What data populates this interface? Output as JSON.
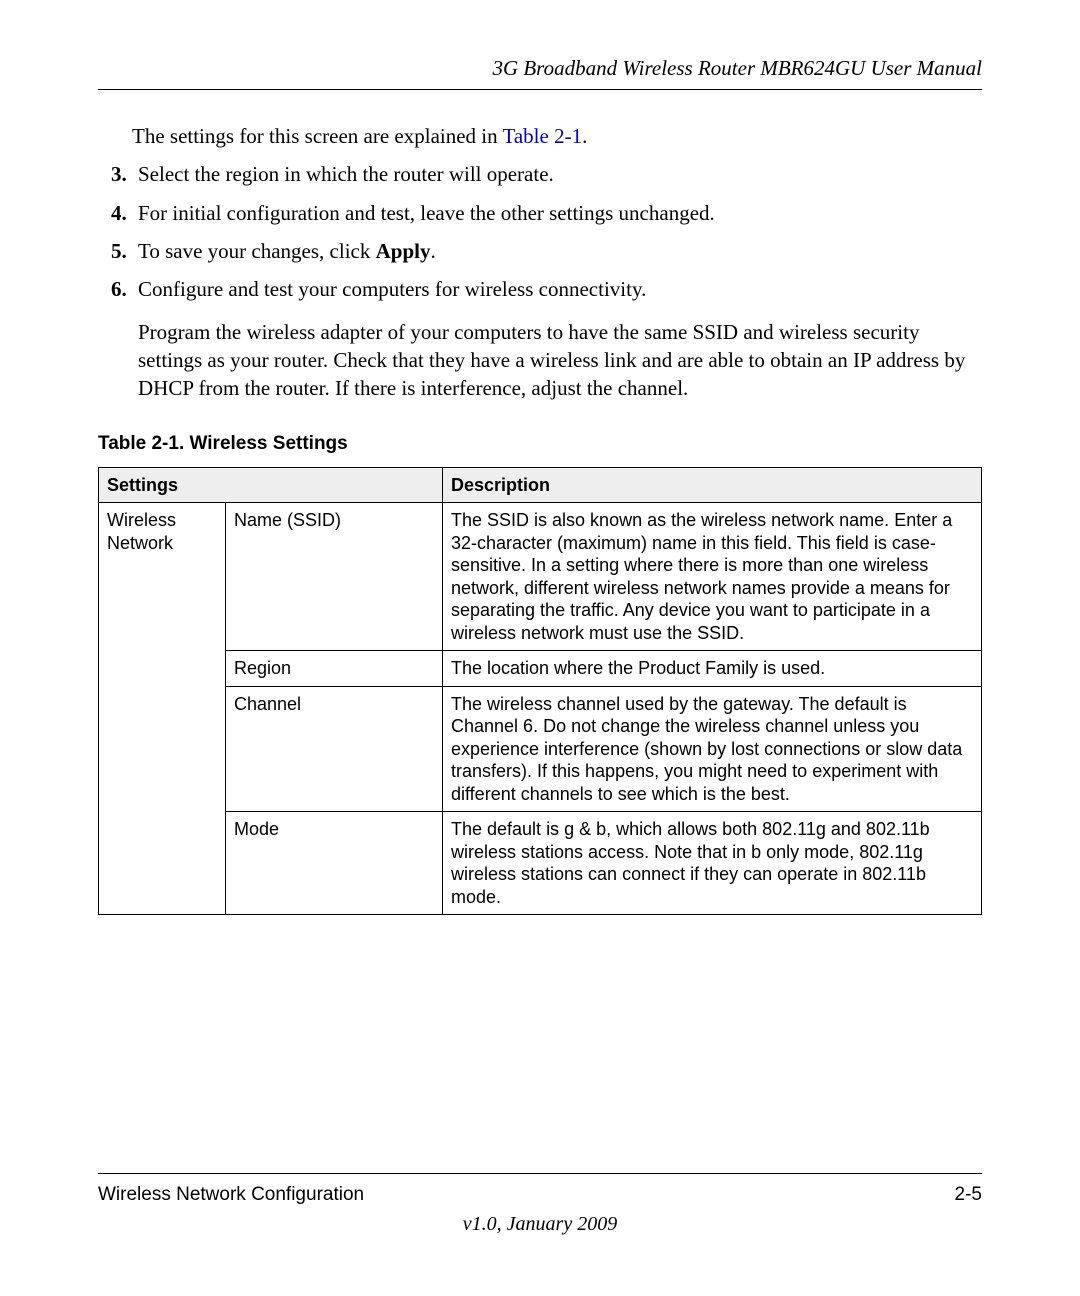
{
  "header": {
    "title": "3G Broadband Wireless Router MBR624GU User Manual"
  },
  "intro": {
    "text_pre": "The settings for this screen are explained in ",
    "link": "Table 2-1",
    "text_post": "."
  },
  "steps": {
    "start": 3,
    "item3": "Select the region in which the router will operate.",
    "item4": "For initial configuration and test, leave the other settings unchanged.",
    "item5_pre": "To save your changes, click ",
    "item5_bold": "Apply",
    "item5_post": ".",
    "item6": "Configure and test your computers for wireless connectivity.",
    "item6_follow": "Program the wireless adapter of your computers to have the same SSID and wireless security settings as your router. Check that they have a wireless link and are able to obtain an IP address by DHCP from the router. If there is interference, adjust the channel."
  },
  "table": {
    "caption": "Table 2-1.   Wireless Settings",
    "head_settings": "Settings",
    "head_description": "Description",
    "group": "Wireless Network",
    "rows": [
      {
        "setting": "Name (SSID)",
        "desc": "The SSID is also known as the wireless network name. Enter a 32-character (maximum) name in this field. This field is case-sensitive.\nIn a setting where there is more than one wireless network, different wireless network names provide a means for separating the traffic. Any device you want to participate in a wireless network must use the SSID."
      },
      {
        "setting": "Region",
        "desc": "The location where the Product Family is used."
      },
      {
        "setting": "Channel",
        "desc": "The wireless channel used by the gateway. The default is Channel 6.\nDo not change the wireless channel unless you experience interference (shown by lost connections or slow data transfers). If this happens, you might need to experiment with different channels to see which is the best."
      },
      {
        "setting": "Mode",
        "desc": "The default is g & b, which allows both 802.11g and 802.11b wireless stations access. Note that in b only mode, 802.11g wireless stations can connect if they can operate in 802.11b mode."
      }
    ]
  },
  "footer": {
    "section": "Wireless Network Configuration",
    "page": "2-5",
    "version": "v1.0, January 2009"
  }
}
